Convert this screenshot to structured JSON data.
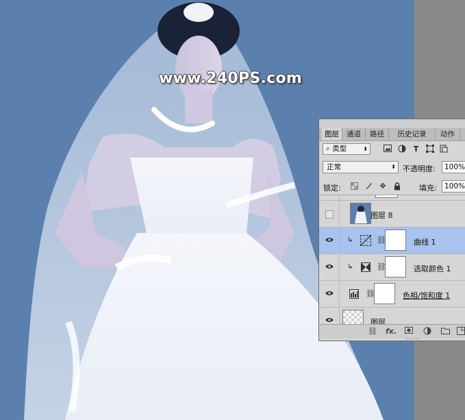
{
  "watermark": "www.240PS.com",
  "panel": {
    "tabs": [
      "图层",
      "通道",
      "路径",
      "历史记录",
      "动作"
    ],
    "filter": {
      "kind_label": "类型",
      "icons": [
        "image-filter-icon",
        "adjustment-filter-icon",
        "type-filter-icon",
        "shape-filter-icon",
        "smart-object-filter-icon"
      ]
    },
    "blend_mode": "正常",
    "opacity_label": "不透明度:",
    "opacity_value": "100%",
    "lock_label": "锁定:",
    "fill_label": "填充:",
    "fill_value": "100%",
    "layers": [
      {
        "name": "图层 8",
        "visible": false,
        "selected": false,
        "type": "pixel"
      },
      {
        "name": "曲线 1",
        "visible": true,
        "selected": true,
        "type": "curves",
        "clipped": true
      },
      {
        "name": "选取颜色 1",
        "visible": true,
        "selected": false,
        "type": "selective-color",
        "clipped": true
      },
      {
        "name": "色相/饱和度 1",
        "visible": true,
        "selected": false,
        "type": "hue-saturation"
      },
      {
        "name": "图层 .",
        "visible": true,
        "selected": false,
        "type": "pixel"
      }
    ],
    "bottom_icons": [
      "link-layers-icon",
      "fx-icon",
      "add-mask-icon",
      "new-adjustment-icon",
      "new-group-icon",
      "new-layer-icon"
    ],
    "colors": {
      "selected_row": "#a7c3ee",
      "panel_bg": "#d6d6d6",
      "canvas_bg": "#5b80ae"
    }
  }
}
